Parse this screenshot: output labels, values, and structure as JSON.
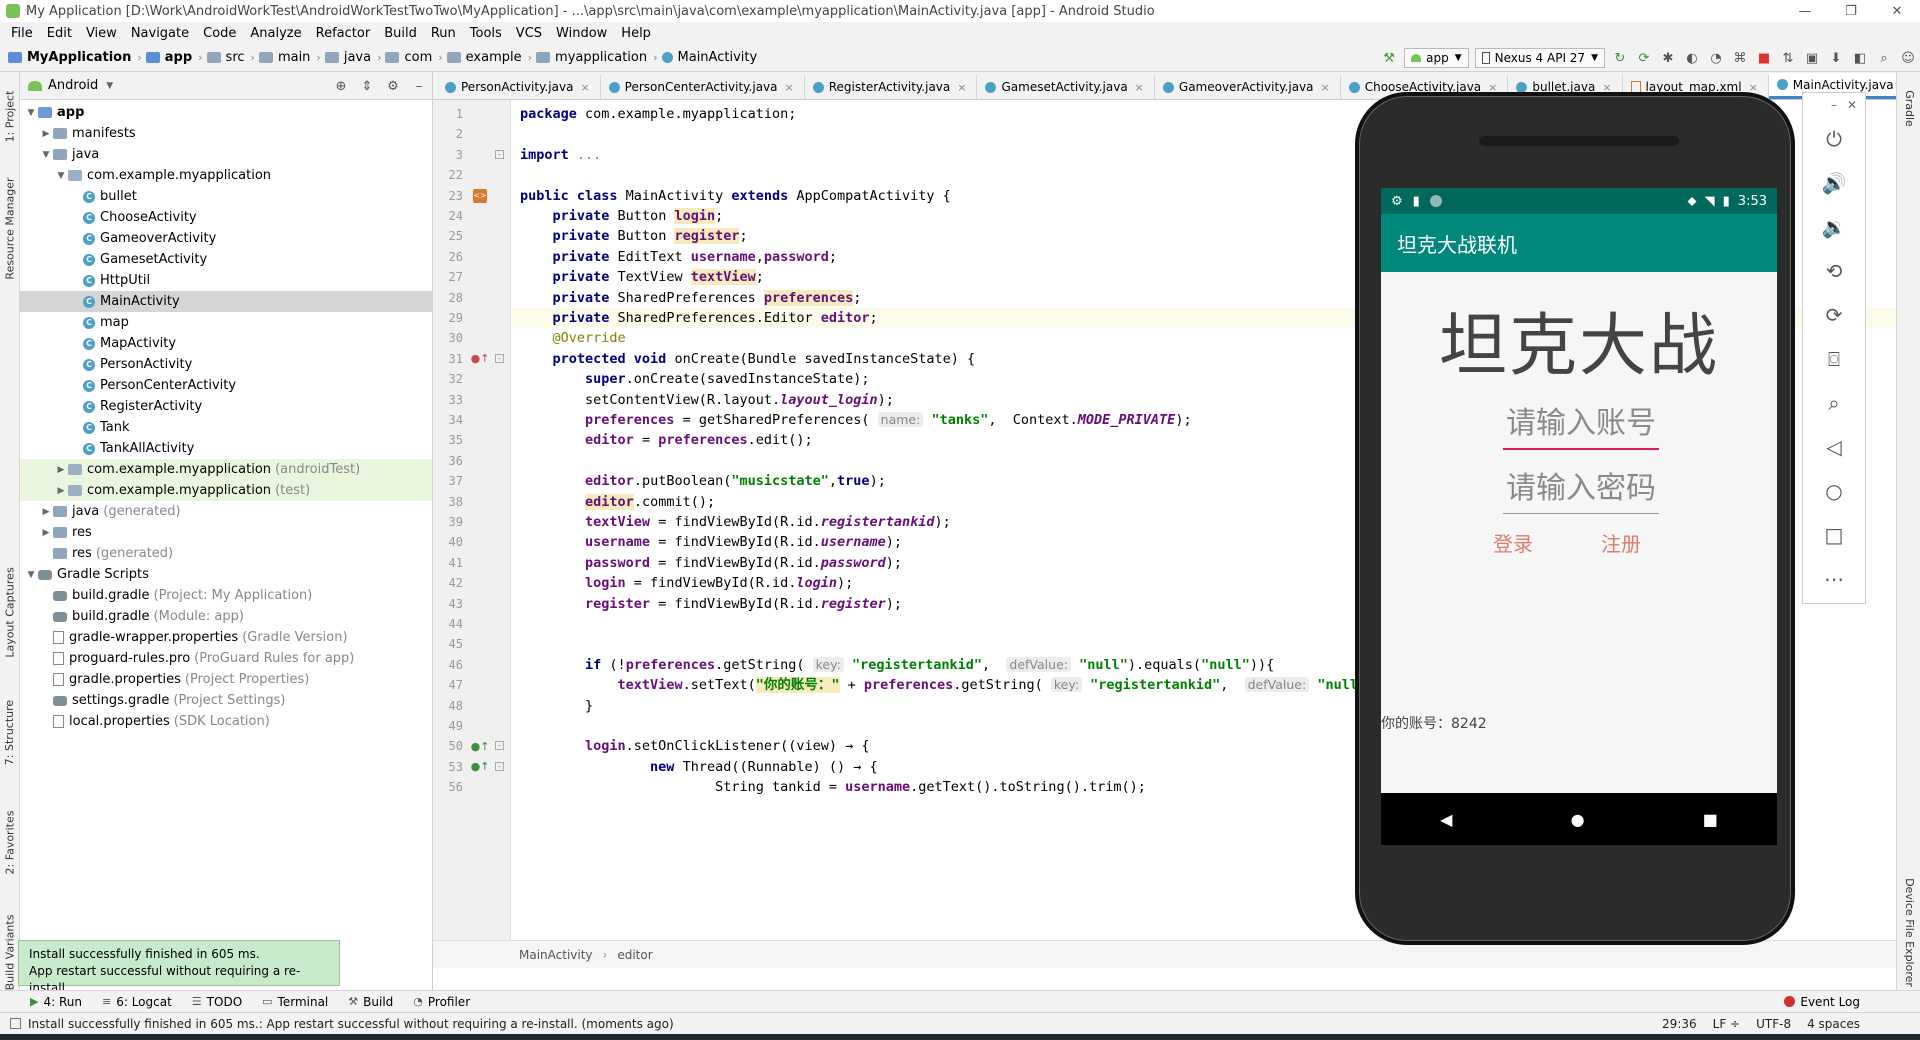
{
  "window": {
    "title": "My Application [D:\\Work\\AndroidWorkTest\\AndroidWorkTestTwoTwo\\MyApplication] - ...\\app\\src\\main\\java\\com\\example\\myapplication\\MainActivity.java [app] - Android Studio",
    "minimize": "—",
    "maximize": "❐",
    "close": "✕"
  },
  "menu": [
    "File",
    "Edit",
    "View",
    "Navigate",
    "Code",
    "Analyze",
    "Refactor",
    "Build",
    "Run",
    "Tools",
    "VCS",
    "Window",
    "Help"
  ],
  "navbar": {
    "crumbs": [
      "MyApplication",
      "app",
      "src",
      "main",
      "java",
      "com",
      "example",
      "myapplication",
      "MainActivity"
    ],
    "run_config": "app",
    "device": "Nexus 4 API 27"
  },
  "left_strip_tabs": [
    "1: Project",
    "Resource Manager",
    "Layout Captures",
    "7: Structure",
    "2: Favorites",
    "Build Variants"
  ],
  "right_strip_tabs": [
    "Gradle",
    "Device File Explorer"
  ],
  "project_panel": {
    "view_mode": "Android",
    "tree": [
      {
        "label": "app",
        "hint": "",
        "indent": 0,
        "arrow": "▼",
        "icon": "folder-blue",
        "bold": true
      },
      {
        "label": "manifests",
        "hint": "",
        "indent": 1,
        "arrow": "▶",
        "icon": "folder"
      },
      {
        "label": "java",
        "hint": "",
        "indent": 1,
        "arrow": "▼",
        "icon": "folder"
      },
      {
        "label": "com.example.myapplication",
        "hint": "",
        "indent": 2,
        "arrow": "▼",
        "icon": "package"
      },
      {
        "label": "bullet",
        "hint": "",
        "indent": 3,
        "arrow": "",
        "icon": "class"
      },
      {
        "label": "ChooseActivity",
        "hint": "",
        "indent": 3,
        "arrow": "",
        "icon": "class"
      },
      {
        "label": "GameoverActivity",
        "hint": "",
        "indent": 3,
        "arrow": "",
        "icon": "class"
      },
      {
        "label": "GamesetActivity",
        "hint": "",
        "indent": 3,
        "arrow": "",
        "icon": "class"
      },
      {
        "label": "HttpUtil",
        "hint": "",
        "indent": 3,
        "arrow": "",
        "icon": "class"
      },
      {
        "label": "MainActivity",
        "hint": "",
        "indent": 3,
        "arrow": "",
        "icon": "class",
        "selected": true
      },
      {
        "label": "map",
        "hint": "",
        "indent": 3,
        "arrow": "",
        "icon": "class"
      },
      {
        "label": "MapActivity",
        "hint": "",
        "indent": 3,
        "arrow": "",
        "icon": "class"
      },
      {
        "label": "PersonActivity",
        "hint": "",
        "indent": 3,
        "arrow": "",
        "icon": "class"
      },
      {
        "label": "PersonCenterActivity",
        "hint": "",
        "indent": 3,
        "arrow": "",
        "icon": "class"
      },
      {
        "label": "RegisterActivity",
        "hint": "",
        "indent": 3,
        "arrow": "",
        "icon": "class"
      },
      {
        "label": "Tank",
        "hint": "",
        "indent": 3,
        "arrow": "",
        "icon": "class"
      },
      {
        "label": "TankAllActivity",
        "hint": "",
        "indent": 3,
        "arrow": "",
        "icon": "class"
      },
      {
        "label": "com.example.myapplication",
        "hint": "(androidTest)",
        "indent": 2,
        "arrow": "▶",
        "icon": "package",
        "green": true
      },
      {
        "label": "com.example.myapplication",
        "hint": "(test)",
        "indent": 2,
        "arrow": "▶",
        "icon": "package",
        "green": true
      },
      {
        "label": "java",
        "hint": "(generated)",
        "indent": 1,
        "arrow": "▶",
        "icon": "folder"
      },
      {
        "label": "res",
        "hint": "",
        "indent": 1,
        "arrow": "▶",
        "icon": "folder"
      },
      {
        "label": "res",
        "hint": "(generated)",
        "indent": 1,
        "arrow": "",
        "icon": "folder"
      },
      {
        "label": "Gradle Scripts",
        "hint": "",
        "indent": 0,
        "arrow": "▼",
        "icon": "gradle"
      },
      {
        "label": "build.gradle",
        "hint": "(Project: My Application)",
        "indent": 1,
        "arrow": "",
        "icon": "gradle"
      },
      {
        "label": "build.gradle",
        "hint": "(Module: app)",
        "indent": 1,
        "arrow": "",
        "icon": "gradle"
      },
      {
        "label": "gradle-wrapper.properties",
        "hint": "(Gradle Version)",
        "indent": 1,
        "arrow": "",
        "icon": "file"
      },
      {
        "label": "proguard-rules.pro",
        "hint": "(ProGuard Rules for app)",
        "indent": 1,
        "arrow": "",
        "icon": "file"
      },
      {
        "label": "gradle.properties",
        "hint": "(Project Properties)",
        "indent": 1,
        "arrow": "",
        "icon": "file"
      },
      {
        "label": "settings.gradle",
        "hint": "(Project Settings)",
        "indent": 1,
        "arrow": "",
        "icon": "gradle"
      },
      {
        "label": "local.properties",
        "hint": "(SDK Location)",
        "indent": 1,
        "arrow": "",
        "icon": "file"
      }
    ]
  },
  "editor_tabs": [
    {
      "label": "PersonActivity.java",
      "type": "class"
    },
    {
      "label": "PersonCenterActivity.java",
      "type": "class"
    },
    {
      "label": "RegisterActivity.java",
      "type": "class"
    },
    {
      "label": "GamesetActivity.java",
      "type": "class"
    },
    {
      "label": "GameoverActivity.java",
      "type": "class"
    },
    {
      "label": "ChooseActivity.java",
      "type": "class"
    },
    {
      "label": "bullet.java",
      "type": "class"
    },
    {
      "label": "layout_map.xml",
      "type": "xml"
    },
    {
      "label": "MainActivity.java",
      "type": "class",
      "active": true
    }
  ],
  "code_lines": [
    {
      "n": "1",
      "html": "<span class='kw'>package</span> com.example.myapplication;"
    },
    {
      "n": "2",
      "html": ""
    },
    {
      "n": "3",
      "html": "<span class='kw'>import</span> <span class='gray'>...</span>",
      "fold": true
    },
    {
      "n": "22",
      "html": ""
    },
    {
      "n": "23",
      "html": "<span class='kw'>public class</span> MainActivity <span class='kw'>extends</span> AppCompatActivity {",
      "mark": "xml"
    },
    {
      "n": "24",
      "html": "    <span class='kw'>private</span> Button <span class='fld hl'>login</span>;"
    },
    {
      "n": "25",
      "html": "    <span class='kw'>private</span> Button <span class='fld hl'>register</span>;"
    },
    {
      "n": "26",
      "html": "    <span class='kw'>private</span> EditText <span class='fld'>username</span>,<span class='fld'>password</span>;"
    },
    {
      "n": "27",
      "html": "    <span class='kw'>private</span> TextView <span class='fld hl'>textView</span>;"
    },
    {
      "n": "28",
      "html": "    <span class='kw'>private</span> SharedPreferences <span class='fld hl'>preferences</span>;"
    },
    {
      "n": "29",
      "html": "    <span class='kw'>private</span> SharedPreferences.Editor <span class='fld'>editor</span>;",
      "current": true
    },
    {
      "n": "30",
      "html": "    <span class='ann'>@Override</span>"
    },
    {
      "n": "31",
      "html": "    <span class='kw'>protected void</span> onCreate(Bundle savedInstanceState) {",
      "mark": "ovr",
      "fold": true
    },
    {
      "n": "32",
      "html": "        <span class='kw'>super</span>.onCreate(savedInstanceState);"
    },
    {
      "n": "33",
      "html": "        setContentView(R.layout.<span class='fld it'>layout_login</span>);"
    },
    {
      "n": "34",
      "html": "        <span class='fld'>preferences</span> = getSharedPreferences( <span class='hint-p'>name:</span> <span class='str'>\"tanks\"</span>,  Context.<span class='fld it'>MODE_PRIVATE</span>);"
    },
    {
      "n": "35",
      "html": "        <span class='fld'>editor</span> = <span class='fld'>preferences</span>.edit();"
    },
    {
      "n": "36",
      "html": ""
    },
    {
      "n": "37",
      "html": "        <span class='fld'>editor</span>.putBoolean(<span class='str'>\"musicstate\"</span>,<span class='kw'>true</span>);"
    },
    {
      "n": "38",
      "html": "        <span class='fld hl'>editor</span>.commit();"
    },
    {
      "n": "39",
      "html": "        <span class='fld'>textView</span> = findViewById(R.id.<span class='fld it'>registertankid</span>);"
    },
    {
      "n": "40",
      "html": "        <span class='fld'>username</span> = findViewById(R.id.<span class='fld it'>username</span>);"
    },
    {
      "n": "41",
      "html": "        <span class='fld'>password</span> = findViewById(R.id.<span class='fld it'>password</span>);"
    },
    {
      "n": "42",
      "html": "        <span class='fld'>login</span> = findViewById(R.id.<span class='fld it'>login</span>);"
    },
    {
      "n": "43",
      "html": "        <span class='fld'>register</span> = findViewById(R.id.<span class='fld it'>register</span>);"
    },
    {
      "n": "44",
      "html": ""
    },
    {
      "n": "45",
      "html": ""
    },
    {
      "n": "46",
      "html": "        <span class='kw'>if</span> (!<span class='fld'>preferences</span>.getString( <span class='hint-p'>key:</span> <span class='str'>\"registertankid\"</span>,  <span class='hint-p'>defValue:</span> <span class='str'>\"null\"</span>).equals(<span class='str'>\"null\"</span>)){"
    },
    {
      "n": "47",
      "html": "            <span class='fld'>textView</span>.setText(<span class='str hl'>\"你的账号：\"</span> + <span class='fld'>preferences</span>.getString( <span class='hint-p'>key:</span> <span class='str'>\"registertankid\"</span>,  <span class='hint-p'>defValue:</span> <span class='str'>\"null\"</span>"
    },
    {
      "n": "48",
      "html": "        }"
    },
    {
      "n": "49",
      "html": ""
    },
    {
      "n": "50",
      "html": "        <span class='fld'>login</span>.setOnClickListener((view) → {",
      "mark": "lam",
      "fold": true
    },
    {
      "n": "53",
      "html": "                <span class='kw'>new</span> Thread((Runnable) () → {",
      "mark": "lam",
      "fold": true
    },
    {
      "n": "56",
      "html": "                        String tankid = <span class='fld'>username</span>.getText().toString().trim();"
    }
  ],
  "editor_breadcrumb": [
    "MainActivity",
    "editor"
  ],
  "emulator": {
    "time": "3:53",
    "app_title": "坦克大战联机",
    "heading": "坦克大战",
    "account_hint": "请输入账号",
    "password_hint": "请输入密码",
    "login": "登录",
    "register": "注册",
    "account_text": "你的账号：8242"
  },
  "notification": {
    "line1": "Install successfully finished in 605 ms.",
    "line2": "App restart successful without requiring a re-install."
  },
  "bottom_tabs": [
    "4: Run",
    "6: Logcat",
    "TODO",
    "Terminal",
    "Build",
    "Profiler"
  ],
  "event_log": "Event Log",
  "status": {
    "message": "Install successfully finished in 605 ms.: App restart successful without requiring a re-install. (moments ago)",
    "position": "29:36",
    "line_sep": "LF ÷",
    "encoding": "UTF-8",
    "indent": "4 spaces"
  }
}
